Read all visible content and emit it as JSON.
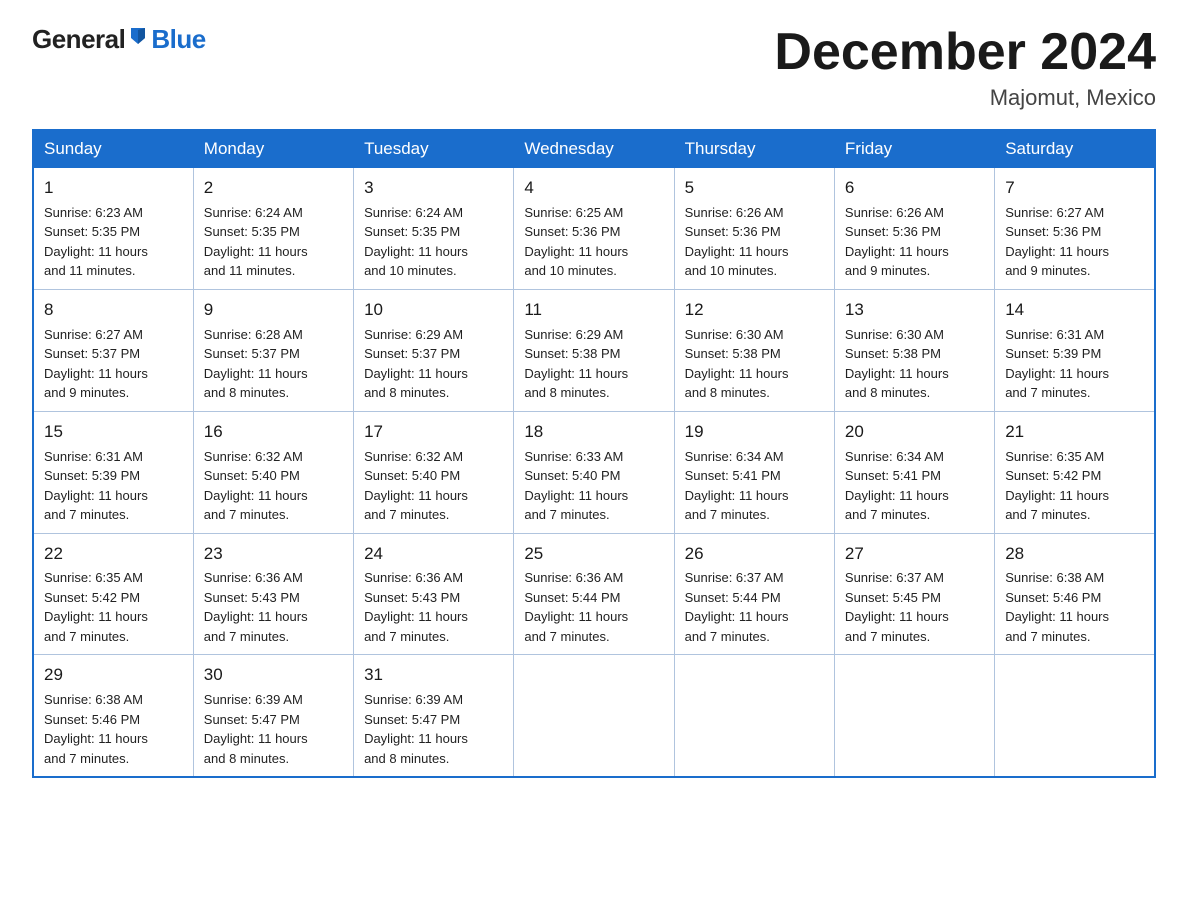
{
  "logo": {
    "general": "General",
    "blue": "Blue"
  },
  "title": {
    "month": "December 2024",
    "location": "Majomut, Mexico"
  },
  "weekdays": [
    "Sunday",
    "Monday",
    "Tuesday",
    "Wednesday",
    "Thursday",
    "Friday",
    "Saturday"
  ],
  "weeks": [
    [
      {
        "day": "1",
        "sunrise": "6:23 AM",
        "sunset": "5:35 PM",
        "daylight": "11 hours and 11 minutes."
      },
      {
        "day": "2",
        "sunrise": "6:24 AM",
        "sunset": "5:35 PM",
        "daylight": "11 hours and 11 minutes."
      },
      {
        "day": "3",
        "sunrise": "6:24 AM",
        "sunset": "5:35 PM",
        "daylight": "11 hours and 10 minutes."
      },
      {
        "day": "4",
        "sunrise": "6:25 AM",
        "sunset": "5:36 PM",
        "daylight": "11 hours and 10 minutes."
      },
      {
        "day": "5",
        "sunrise": "6:26 AM",
        "sunset": "5:36 PM",
        "daylight": "11 hours and 10 minutes."
      },
      {
        "day": "6",
        "sunrise": "6:26 AM",
        "sunset": "5:36 PM",
        "daylight": "11 hours and 9 minutes."
      },
      {
        "day": "7",
        "sunrise": "6:27 AM",
        "sunset": "5:36 PM",
        "daylight": "11 hours and 9 minutes."
      }
    ],
    [
      {
        "day": "8",
        "sunrise": "6:27 AM",
        "sunset": "5:37 PM",
        "daylight": "11 hours and 9 minutes."
      },
      {
        "day": "9",
        "sunrise": "6:28 AM",
        "sunset": "5:37 PM",
        "daylight": "11 hours and 8 minutes."
      },
      {
        "day": "10",
        "sunrise": "6:29 AM",
        "sunset": "5:37 PM",
        "daylight": "11 hours and 8 minutes."
      },
      {
        "day": "11",
        "sunrise": "6:29 AM",
        "sunset": "5:38 PM",
        "daylight": "11 hours and 8 minutes."
      },
      {
        "day": "12",
        "sunrise": "6:30 AM",
        "sunset": "5:38 PM",
        "daylight": "11 hours and 8 minutes."
      },
      {
        "day": "13",
        "sunrise": "6:30 AM",
        "sunset": "5:38 PM",
        "daylight": "11 hours and 8 minutes."
      },
      {
        "day": "14",
        "sunrise": "6:31 AM",
        "sunset": "5:39 PM",
        "daylight": "11 hours and 7 minutes."
      }
    ],
    [
      {
        "day": "15",
        "sunrise": "6:31 AM",
        "sunset": "5:39 PM",
        "daylight": "11 hours and 7 minutes."
      },
      {
        "day": "16",
        "sunrise": "6:32 AM",
        "sunset": "5:40 PM",
        "daylight": "11 hours and 7 minutes."
      },
      {
        "day": "17",
        "sunrise": "6:32 AM",
        "sunset": "5:40 PM",
        "daylight": "11 hours and 7 minutes."
      },
      {
        "day": "18",
        "sunrise": "6:33 AM",
        "sunset": "5:40 PM",
        "daylight": "11 hours and 7 minutes."
      },
      {
        "day": "19",
        "sunrise": "6:34 AM",
        "sunset": "5:41 PM",
        "daylight": "11 hours and 7 minutes."
      },
      {
        "day": "20",
        "sunrise": "6:34 AM",
        "sunset": "5:41 PM",
        "daylight": "11 hours and 7 minutes."
      },
      {
        "day": "21",
        "sunrise": "6:35 AM",
        "sunset": "5:42 PM",
        "daylight": "11 hours and 7 minutes."
      }
    ],
    [
      {
        "day": "22",
        "sunrise": "6:35 AM",
        "sunset": "5:42 PM",
        "daylight": "11 hours and 7 minutes."
      },
      {
        "day": "23",
        "sunrise": "6:36 AM",
        "sunset": "5:43 PM",
        "daylight": "11 hours and 7 minutes."
      },
      {
        "day": "24",
        "sunrise": "6:36 AM",
        "sunset": "5:43 PM",
        "daylight": "11 hours and 7 minutes."
      },
      {
        "day": "25",
        "sunrise": "6:36 AM",
        "sunset": "5:44 PM",
        "daylight": "11 hours and 7 minutes."
      },
      {
        "day": "26",
        "sunrise": "6:37 AM",
        "sunset": "5:44 PM",
        "daylight": "11 hours and 7 minutes."
      },
      {
        "day": "27",
        "sunrise": "6:37 AM",
        "sunset": "5:45 PM",
        "daylight": "11 hours and 7 minutes."
      },
      {
        "day": "28",
        "sunrise": "6:38 AM",
        "sunset": "5:46 PM",
        "daylight": "11 hours and 7 minutes."
      }
    ],
    [
      {
        "day": "29",
        "sunrise": "6:38 AM",
        "sunset": "5:46 PM",
        "daylight": "11 hours and 7 minutes."
      },
      {
        "day": "30",
        "sunrise": "6:39 AM",
        "sunset": "5:47 PM",
        "daylight": "11 hours and 8 minutes."
      },
      {
        "day": "31",
        "sunrise": "6:39 AM",
        "sunset": "5:47 PM",
        "daylight": "11 hours and 8 minutes."
      },
      null,
      null,
      null,
      null
    ]
  ],
  "labels": {
    "sunrise": "Sunrise:",
    "sunset": "Sunset:",
    "daylight": "Daylight:"
  }
}
